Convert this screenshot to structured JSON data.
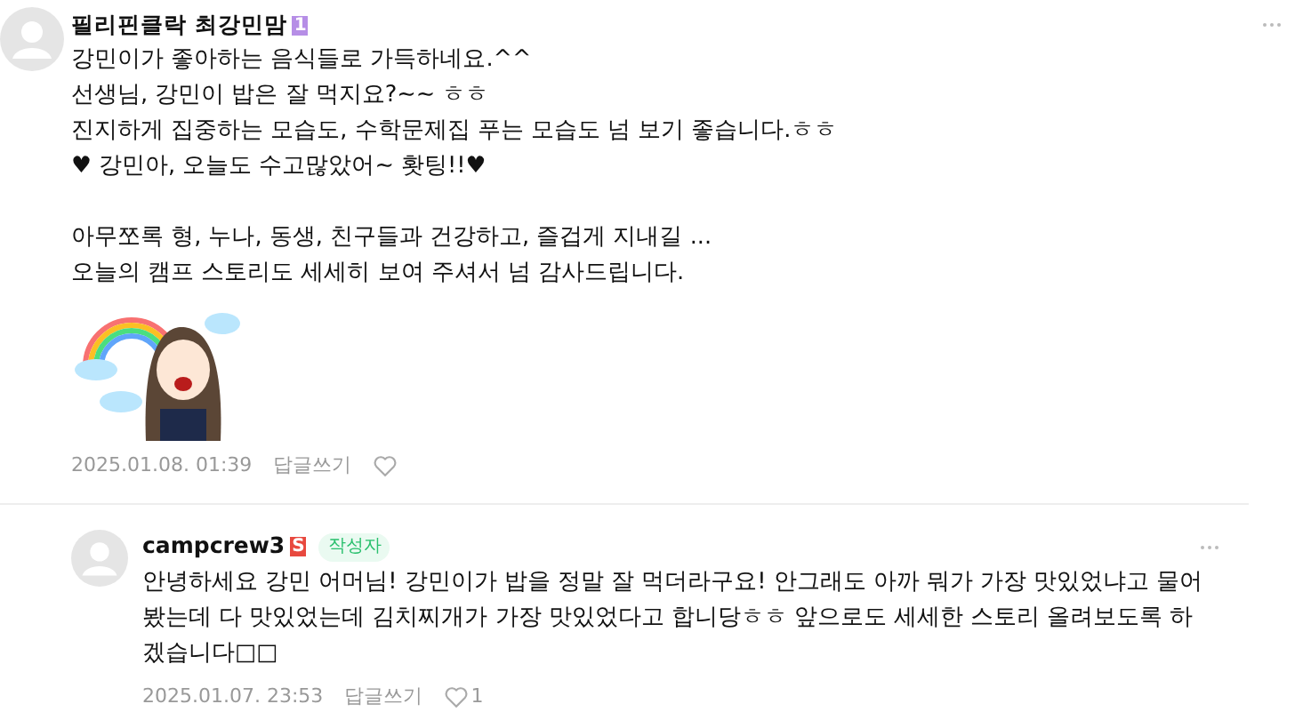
{
  "comments": [
    {
      "author": "필리핀클락 최강민맘",
      "level_badge": "1",
      "paragraphs": [
        [
          "강민이가 좋아하는 음식들로 가득하네요.^^",
          "선생님, 강민이 밥은 잘 먹지요?~~ ㅎㅎ",
          "진지하게 집중하는 모습도, 수학문제집 푸는 모습도 넘 보기 좋습니다.ㅎㅎ",
          "♥ 강민아, 오늘도 수고많았어~ 홧팅!!♥"
        ],
        [
          "아무쪼록 형, 누나, 동생, 친구들과 건강하고, 즐겁게 지내길 ...",
          "오늘의 캠프 스토리도 세세히 보여 주셔서 넘 감사드립니다."
        ]
      ],
      "sticker": true,
      "date": "2025.01.08. 01:39",
      "reply_label": "답글쓰기",
      "is_reply": false
    },
    {
      "author": "campcrew3",
      "level_badge": "S",
      "author_tag": "작성자",
      "paragraphs": [
        [
          "안녕하세요 강민 어머님! 강민이가 밥을 정말 잘 먹더라구요! 안그래도 아까 뭐가 가장 맛있었냐고 물어봤는데 다 맛있었는데 김치찌개가 가장 맛있었다고 합니당ㅎㅎ 앞으로도 세세한 스토리 올려보도록 하겠습니다□□"
        ]
      ],
      "sticker": false,
      "date": "2025.01.07. 23:53",
      "reply_label": "답글쓰기",
      "like_count": "1",
      "is_reply": true
    }
  ]
}
